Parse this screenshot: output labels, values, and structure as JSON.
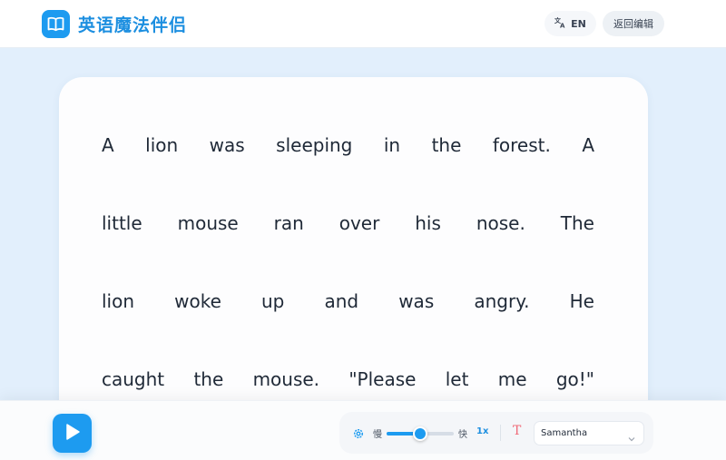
{
  "header": {
    "app_title": "英语魔法伴侣",
    "lang_label": "EN",
    "back_label": "返回编辑"
  },
  "story": {
    "lines": [
      [
        "A",
        "lion",
        "was",
        "sleeping",
        "in",
        "the",
        "forest.",
        "A"
      ],
      [
        "little",
        "mouse",
        "ran",
        "over",
        "his",
        "nose.",
        "The"
      ],
      [
        "lion",
        "woke",
        "up",
        "and",
        "was",
        "angry.",
        "He"
      ],
      [
        "caught",
        "the",
        "mouse.",
        "\"Please",
        "let",
        "me",
        "go!\""
      ]
    ]
  },
  "controls": {
    "slow_label": "慢",
    "fast_label": "快",
    "speed_value": "1x",
    "speed_fraction": 0.5,
    "voice_selected": "Samantha"
  },
  "colors": {
    "accent": "#1d9bf0",
    "background": "#e2effc",
    "text_icon": "#f06a78"
  },
  "icons": {
    "logo": "book-icon",
    "lang": "translate-icon",
    "play": "play-icon",
    "settings": "gear-icon",
    "text": "text-format-icon",
    "dropdown": "chevron-down-icon"
  }
}
